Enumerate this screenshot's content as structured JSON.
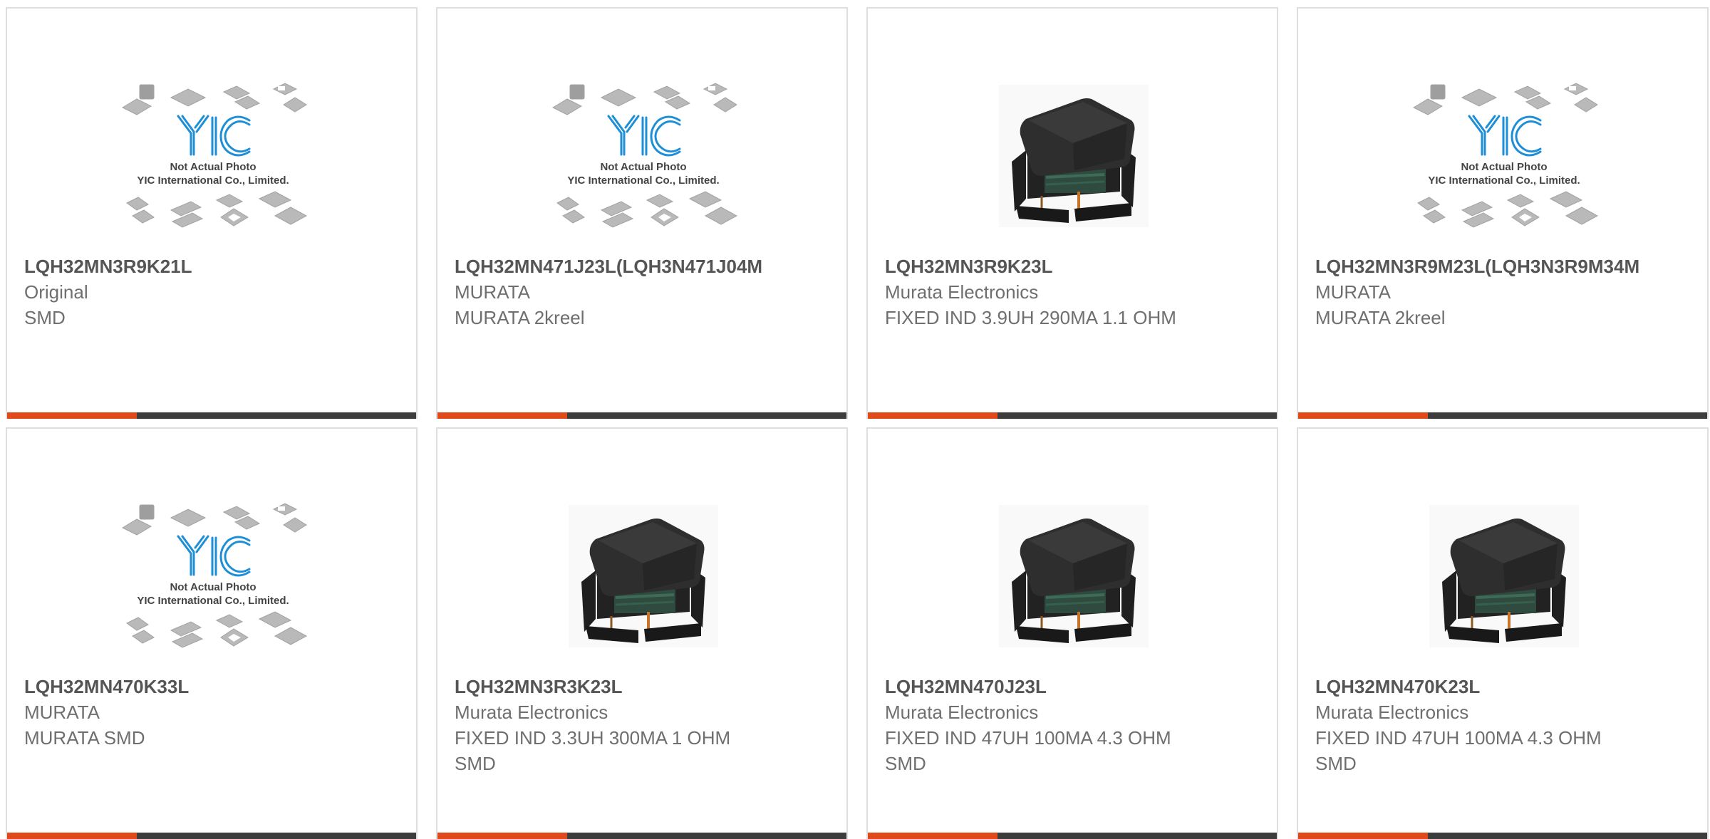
{
  "placeholder": {
    "logo_text": "YIC",
    "caption_line1": "Not Actual Photo",
    "caption_line2": "YIC International Co., Limited."
  },
  "colors": {
    "accent": "#e04a1a",
    "bar_dark": "#3d3d3d",
    "logo_blue": "#1e8fd6"
  },
  "products": [
    {
      "part_number": "LQH32MN3R9K21L",
      "line1": "Original",
      "line2": "SMD",
      "image": "placeholder-photo"
    },
    {
      "part_number": "LQH32MN471J23L(LQH3N471J04M",
      "line1": "MURATA",
      "line2": "MURATA 2kreel",
      "image": "placeholder-photo"
    },
    {
      "part_number": "LQH32MN3R9K23L",
      "line1": "Murata Electronics",
      "line2": "FIXED IND 3.9UH 290MA 1.1 OHM",
      "image": "inductor-photo"
    },
    {
      "part_number": "LQH32MN3R9M23L(LQH3N3R9M34M",
      "line1": "MURATA",
      "line2": "MURATA 2kreel",
      "image": "placeholder-photo"
    },
    {
      "part_number": "LQH32MN470K33L",
      "line1": "MURATA",
      "line2": "MURATA SMD",
      "image": "placeholder-photo"
    },
    {
      "part_number": "LQH32MN3R3K23L",
      "line1": "Murata Electronics",
      "line2": "FIXED IND 3.3UH 300MA 1 OHM SMD",
      "image": "inductor-photo"
    },
    {
      "part_number": "LQH32MN470J23L",
      "line1": "Murata Electronics",
      "line2": "FIXED IND 47UH 100MA 4.3 OHM SMD",
      "image": "inductor-photo"
    },
    {
      "part_number": "LQH32MN470K23L",
      "line1": "Murata Electronics",
      "line2": "FIXED IND 47UH 100MA 4.3 OHM SMD",
      "image": "inductor-photo"
    }
  ]
}
